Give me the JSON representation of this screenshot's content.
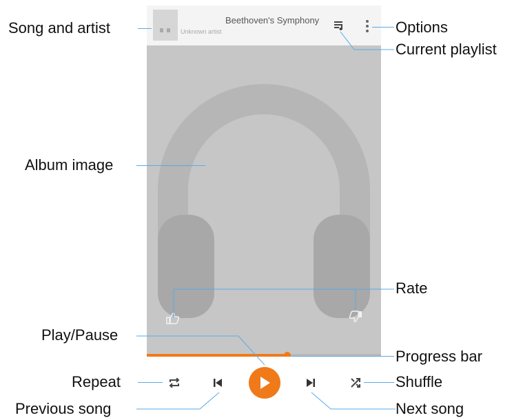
{
  "player": {
    "song_title": "Beethoven's Symphony",
    "artist": "Unknown artist",
    "progress_fraction": 0.6,
    "accent_color": "#f07a1a",
    "icons": {
      "options": "more-vert-icon",
      "playlist": "queue-music-icon",
      "thumb_up": "thumb-up-icon",
      "thumb_down": "thumb-down-icon",
      "repeat": "repeat-icon",
      "previous": "skip-previous-icon",
      "play": "play-icon",
      "next": "skip-next-icon",
      "shuffle": "shuffle-icon",
      "album_art": "headphones-icon"
    }
  },
  "annotations": {
    "song_and_artist": "Song and artist",
    "options": "Options",
    "current_playlist": "Current playlist",
    "album_image": "Album image",
    "rate": "Rate",
    "play_pause": "Play/Pause",
    "progress_bar": "Progress bar",
    "repeat": "Repeat",
    "shuffle": "Shuffle",
    "previous_song": "Previous song",
    "next_song": "Next song"
  }
}
